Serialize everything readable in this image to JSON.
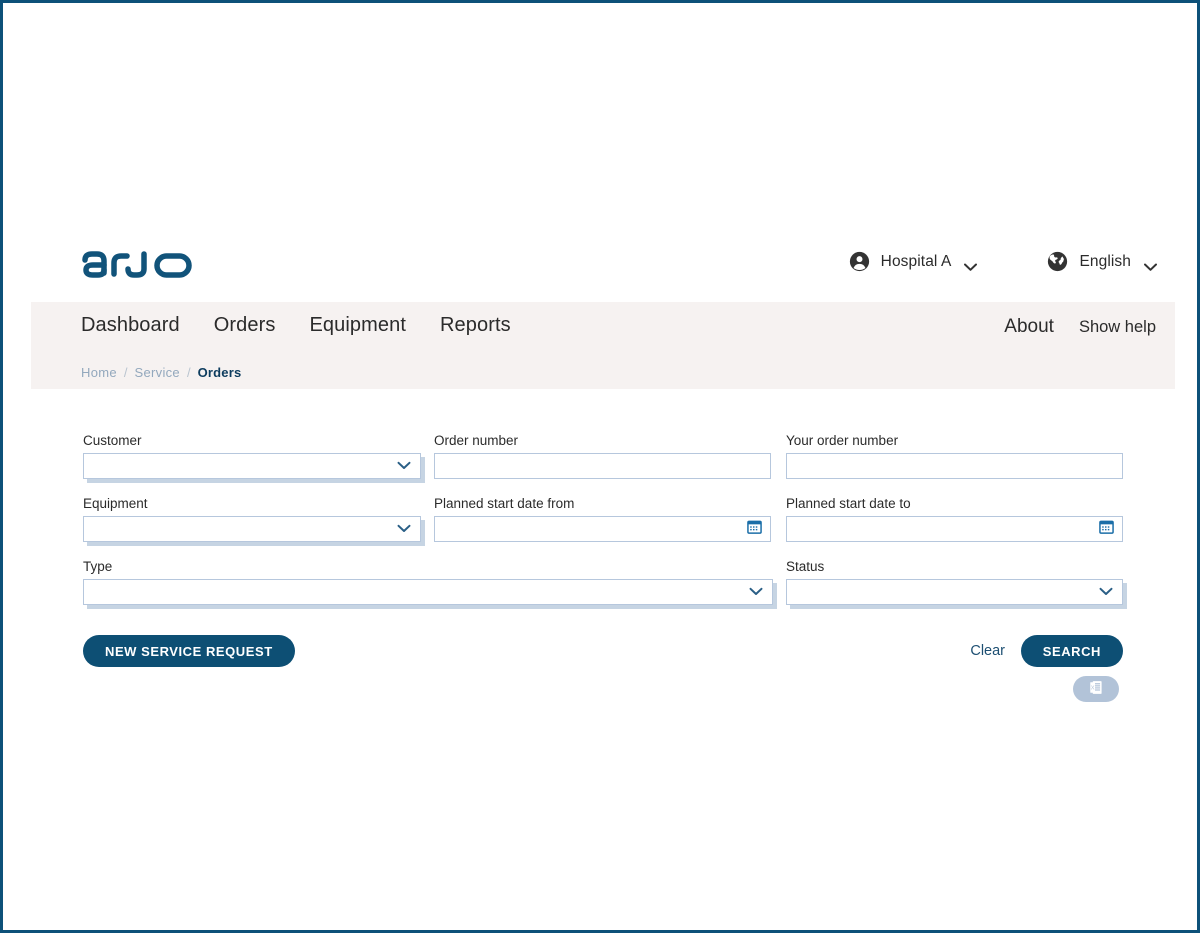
{
  "brand": {
    "logo_text": "arjo",
    "logo_color": "#11537a",
    "accent_color": "#0d4f74",
    "nav_band_color": "#f6f2f1",
    "frame_border_color": "#0d5179"
  },
  "header": {
    "account": {
      "icon": "account-circle-icon",
      "label": "Hospital A",
      "caret": "chevron-down-icon"
    },
    "language": {
      "icon": "globe-icon",
      "label": "English",
      "caret": "chevron-down-icon"
    }
  },
  "nav": {
    "items": [
      {
        "label": "Dashboard"
      },
      {
        "label": "Orders"
      },
      {
        "label": "Equipment"
      },
      {
        "label": "Reports"
      }
    ],
    "about_label": "About",
    "help_label": "Show help"
  },
  "breadcrumb": {
    "items": [
      {
        "label": "Home",
        "current": false
      },
      {
        "label": "Service",
        "current": false
      },
      {
        "label": "Orders",
        "current": true
      }
    ],
    "separator": "/"
  },
  "form": {
    "fields": {
      "customer": {
        "label": "Customer",
        "value": "",
        "type": "select"
      },
      "order_number": {
        "label": "Order number",
        "value": "",
        "type": "text"
      },
      "your_order_number": {
        "label": "Your order number",
        "value": "",
        "type": "text"
      },
      "equipment": {
        "label": "Equipment",
        "value": "",
        "type": "select"
      },
      "start_from": {
        "label": "Planned start date from",
        "value": "",
        "type": "date"
      },
      "start_to": {
        "label": "Planned start date to",
        "value": "",
        "type": "date"
      },
      "type": {
        "label": "Type",
        "value": "",
        "type": "select"
      },
      "status": {
        "label": "Status",
        "value": "",
        "type": "select"
      }
    }
  },
  "actions": {
    "new_service_request": "NEW SERVICE REQUEST",
    "clear": "Clear",
    "search": "SEARCH",
    "export_icon": "excel-export-icon"
  }
}
